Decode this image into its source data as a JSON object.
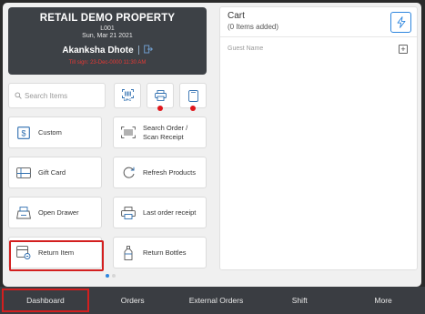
{
  "store": {
    "name": "RETAIL DEMO PROPERTY",
    "code": "L001",
    "date": "Sun, Mar 21 2021",
    "user": "Akanksha Dhote",
    "warning": "Till sign: 23-Dec-0000 11:30 AM"
  },
  "search": {
    "placeholder": "Search Items"
  },
  "mini_tiles": [
    {
      "icon": "upc-scan-icon",
      "caption": "UPC"
    },
    {
      "icon": "printer-icon",
      "status": "red-dot"
    },
    {
      "icon": "tablet-icon",
      "status": "red-dot"
    }
  ],
  "actions": {
    "custom": "Custom",
    "scan_order": "Search Order / Scan Receipt",
    "scan_order_l1": "Search Order /",
    "scan_order_l2": "Scan Receipt",
    "gift_card": "Gift Card",
    "refresh_products": "Refresh Products",
    "open_drawer": "Open Drawer",
    "last_receipt": "Last order receipt",
    "return_item": "Return Item",
    "return_bottles": "Return Bottles"
  },
  "cart": {
    "title": "Cart",
    "count": "(0 Items added)",
    "guest_placeholder": "Guest Name"
  },
  "nav": {
    "dashboard": "Dashboard",
    "orders": "Orders",
    "external_orders": "External Orders",
    "shift": "Shift",
    "more": "More"
  },
  "colors": {
    "accent": "#2e86de",
    "highlight": "#d31f1f",
    "header_bg": "#3d4146",
    "nav_bg": "#3a3d42"
  }
}
